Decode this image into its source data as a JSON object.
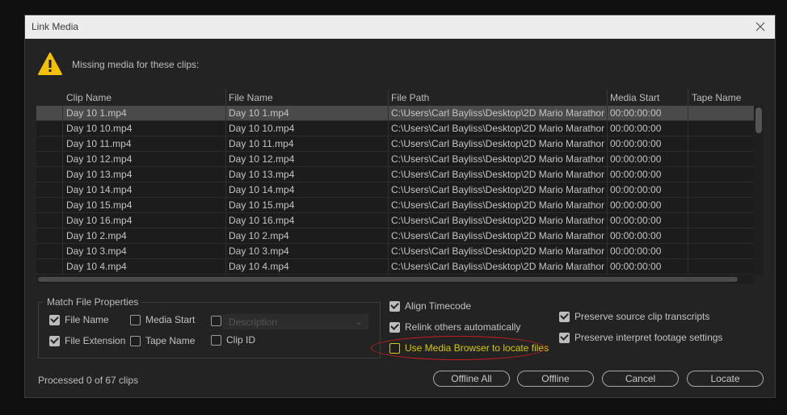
{
  "dialog": {
    "title": "Link Media",
    "close_icon": "close-icon",
    "missing_text": "Missing media for these clips:",
    "warning_icon": "warning-icon"
  },
  "table": {
    "headers": [
      "Clip Name",
      "File Name",
      "File Path",
      "Media Start",
      "Tape Name"
    ],
    "rows": [
      {
        "clip": "Day 10 1.mp4",
        "file": "Day 10 1.mp4",
        "path": "C:\\Users\\Carl Bayliss\\Desktop\\2D Mario Marathon\\Da",
        "start": "00:00:00:00",
        "tape": ""
      },
      {
        "clip": "Day 10 10.mp4",
        "file": "Day 10 10.mp4",
        "path": "C:\\Users\\Carl Bayliss\\Desktop\\2D Mario Marathon\\Da",
        "start": "00:00:00:00",
        "tape": ""
      },
      {
        "clip": "Day 10 11.mp4",
        "file": "Day 10 11.mp4",
        "path": "C:\\Users\\Carl Bayliss\\Desktop\\2D Mario Marathon\\Da",
        "start": "00:00:00:00",
        "tape": ""
      },
      {
        "clip": "Day 10 12.mp4",
        "file": "Day 10 12.mp4",
        "path": "C:\\Users\\Carl Bayliss\\Desktop\\2D Mario Marathon\\Da",
        "start": "00:00:00:00",
        "tape": ""
      },
      {
        "clip": "Day 10 13.mp4",
        "file": "Day 10 13.mp4",
        "path": "C:\\Users\\Carl Bayliss\\Desktop\\2D Mario Marathon\\Da",
        "start": "00:00:00:00",
        "tape": ""
      },
      {
        "clip": "Day 10 14.mp4",
        "file": "Day 10 14.mp4",
        "path": "C:\\Users\\Carl Bayliss\\Desktop\\2D Mario Marathon\\Da",
        "start": "00:00:00:00",
        "tape": ""
      },
      {
        "clip": "Day 10 15.mp4",
        "file": "Day 10 15.mp4",
        "path": "C:\\Users\\Carl Bayliss\\Desktop\\2D Mario Marathon\\Da",
        "start": "00:00:00:00",
        "tape": ""
      },
      {
        "clip": "Day 10 16.mp4",
        "file": "Day 10 16.mp4",
        "path": "C:\\Users\\Carl Bayliss\\Desktop\\2D Mario Marathon\\Da",
        "start": "00:00:00:00",
        "tape": ""
      },
      {
        "clip": "Day 10 2.mp4",
        "file": "Day 10 2.mp4",
        "path": "C:\\Users\\Carl Bayliss\\Desktop\\2D Mario Marathon\\Da",
        "start": "00:00:00:00",
        "tape": ""
      },
      {
        "clip": "Day 10 3.mp4",
        "file": "Day 10 3.mp4",
        "path": "C:\\Users\\Carl Bayliss\\Desktop\\2D Mario Marathon\\Da",
        "start": "00:00:00:00",
        "tape": ""
      },
      {
        "clip": "Day 10 4.mp4",
        "file": "Day 10 4.mp4",
        "path": "C:\\Users\\Carl Bayliss\\Desktop\\2D Mario Marathon\\Da",
        "start": "00:00:00:00",
        "tape": ""
      }
    ]
  },
  "match": {
    "legend": "Match File Properties",
    "file_name": {
      "label": "File Name",
      "checked": true
    },
    "media_start": {
      "label": "Media Start",
      "checked": false
    },
    "description": {
      "label": "Description",
      "checked": false
    },
    "file_extension": {
      "label": "File Extension",
      "checked": true
    },
    "tape_name": {
      "label": "Tape Name",
      "checked": false
    },
    "clip_id": {
      "label": "Clip ID",
      "checked": false
    }
  },
  "options": {
    "align_timecode": {
      "label": "Align Timecode",
      "checked": true
    },
    "relink_others": {
      "label": "Relink others automatically",
      "checked": true
    },
    "media_browser": {
      "label": "Use Media Browser to locate files",
      "checked": false
    },
    "preserve_transcripts": {
      "label": "Preserve source clip transcripts",
      "checked": true
    },
    "preserve_interpret": {
      "label": "Preserve interpret footage settings",
      "checked": true
    }
  },
  "status": {
    "processed": "Processed 0 of 67 clips"
  },
  "buttons": {
    "offline_all": "Offline All",
    "offline": "Offline",
    "cancel": "Cancel",
    "locate": "Locate"
  },
  "colors": {
    "highlight_ellipse": "#c81e1e",
    "media_browser_label": "#d4c800",
    "warning": "#f2c200"
  }
}
